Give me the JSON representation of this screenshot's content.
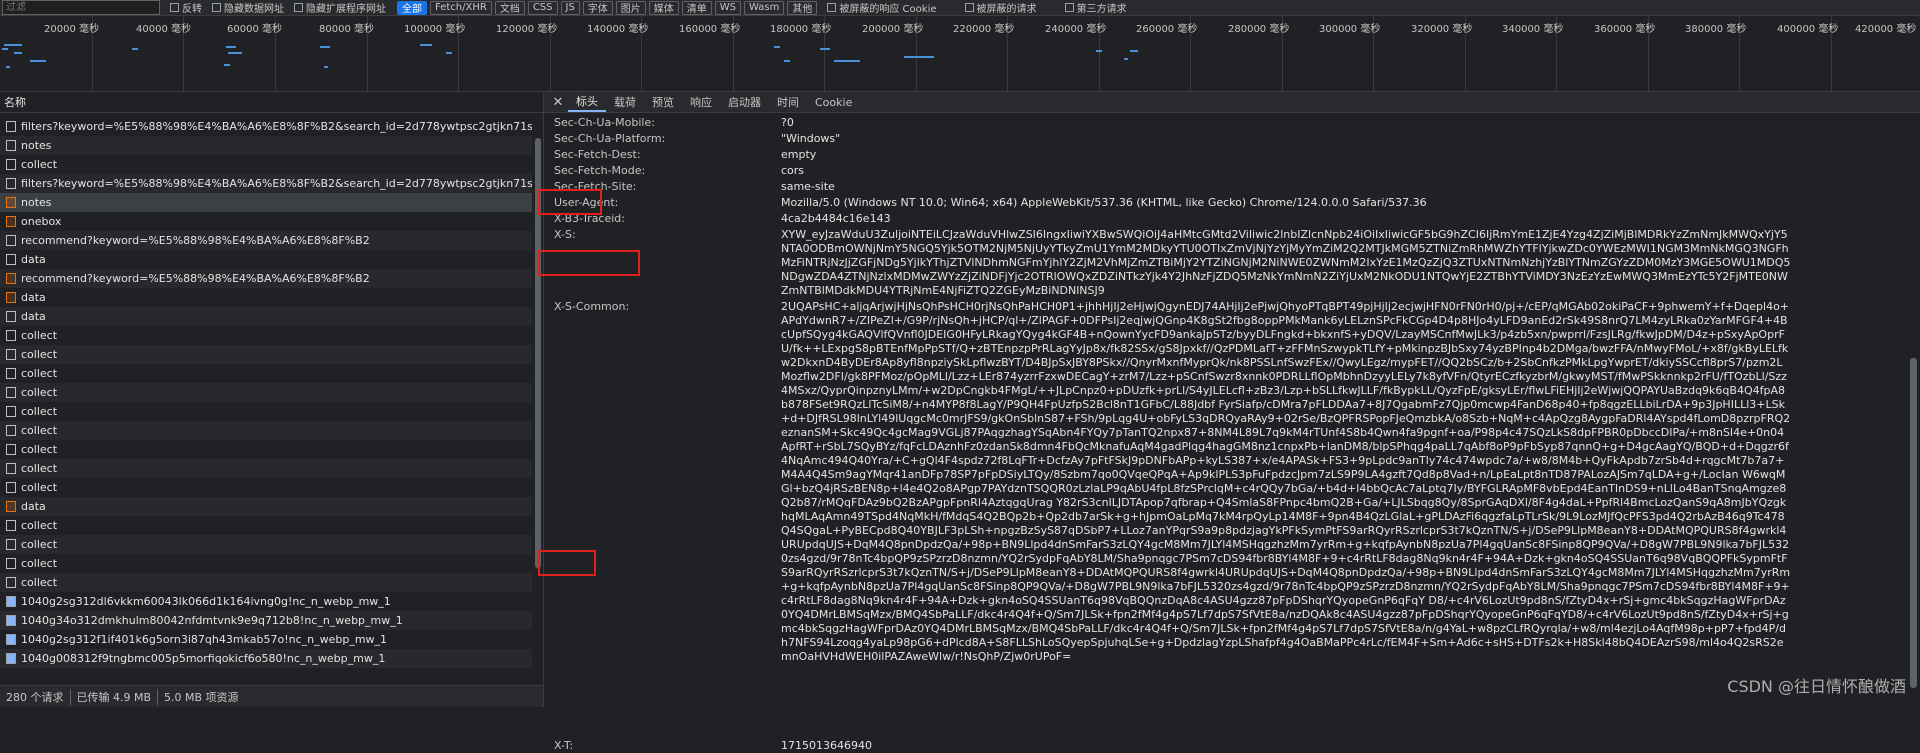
{
  "filterbar": {
    "placeholder": "过滤",
    "checks": [
      "反转",
      "隐藏数据网址",
      "隐藏扩展程序网址"
    ],
    "types": [
      "全部",
      "Fetch/XHR",
      "文档",
      "CSS",
      "JS",
      "字体",
      "图片",
      "媒体",
      "清单",
      "WS",
      "Wasm",
      "其他"
    ],
    "active_type": "全部",
    "checks2": [
      "被屏蔽的响应 Cookie",
      "被屏蔽的请求",
      "第三方请求"
    ]
  },
  "timeline": {
    "ticks": [
      "20000 毫秒",
      "40000 毫秒",
      "60000 毫秒",
      "80000 毫秒",
      "100000 毫秒",
      "120000 毫秒",
      "140000 毫秒",
      "160000 毫秒",
      "180000 毫秒",
      "200000 毫秒",
      "220000 毫秒",
      "240000 毫秒",
      "260000 毫秒",
      "280000 毫秒",
      "300000 毫秒",
      "320000 毫秒",
      "340000 毫秒",
      "360000 毫秒",
      "380000 毫秒",
      "400000 毫秒",
      "420000 毫秒"
    ]
  },
  "requests": {
    "header": "名称",
    "rows": [
      {
        "name": "filters?keyword=%E5%88%98%E4%BA%A6%E8%8F%B2&search_id=2d778ywtpsc2gtjkn71s6",
        "icon": "doc"
      },
      {
        "name": "notes",
        "icon": "doc"
      },
      {
        "name": "collect",
        "icon": "doc"
      },
      {
        "name": "filters?keyword=%E5%88%98%E4%BA%A6%E8%8F%B2&search_id=2d778ywtpsc2gtjkn71s6",
        "icon": "doc"
      },
      {
        "name": "notes",
        "icon": "xhr"
      },
      {
        "name": "onebox",
        "icon": "xhr"
      },
      {
        "name": "recommend?keyword=%E5%88%98%E4%BA%A6%E8%8F%B2",
        "icon": "doc"
      },
      {
        "name": "data",
        "icon": "doc"
      },
      {
        "name": "recommend?keyword=%E5%88%98%E4%BA%A6%E8%8F%B2",
        "icon": "xhr"
      },
      {
        "name": "data",
        "icon": "xhr"
      },
      {
        "name": "data",
        "icon": "doc"
      },
      {
        "name": "collect",
        "icon": "doc"
      },
      {
        "name": "collect",
        "icon": "doc"
      },
      {
        "name": "collect",
        "icon": "doc"
      },
      {
        "name": "collect",
        "icon": "doc"
      },
      {
        "name": "collect",
        "icon": "doc"
      },
      {
        "name": "collect",
        "icon": "doc"
      },
      {
        "name": "collect",
        "icon": "doc"
      },
      {
        "name": "collect",
        "icon": "doc"
      },
      {
        "name": "collect",
        "icon": "doc"
      },
      {
        "name": "data",
        "icon": "xhr"
      },
      {
        "name": "collect",
        "icon": "doc"
      },
      {
        "name": "collect",
        "icon": "doc"
      },
      {
        "name": "collect",
        "icon": "doc"
      },
      {
        "name": "collect",
        "icon": "doc"
      },
      {
        "name": "1040g2sg312dl6vkkm60043lk066d1k164ivng0g!nc_n_webp_mw_1",
        "icon": "img"
      },
      {
        "name": "1040g34o312dmkhulm80042nfdmtvnk9e9q712b8!nc_n_webp_mw_1",
        "icon": "img"
      },
      {
        "name": "1040g2sg312f1if401k6g5orn3i87qh43mkab57o!nc_n_webp_mw_1",
        "icon": "img"
      },
      {
        "name": "1040g008312f9tngbmc005p5morfiqokicf6o580!nc_n_webp_mw_1",
        "icon": "img"
      }
    ],
    "selected_index": 4
  },
  "status": {
    "count": "280 个请求",
    "transferred": "已传输 4.9 MB",
    "resources": "5.0 MB 项资源"
  },
  "detail": {
    "tabs": [
      "标头",
      "载荷",
      "预览",
      "响应",
      "启动器",
      "时间",
      "Cookie"
    ],
    "active_tab": "标头",
    "headers": [
      {
        "name": "Sec-Ch-Ua-Mobile:",
        "value": "?0"
      },
      {
        "name": "Sec-Ch-Ua-Platform:",
        "value": "\"Windows\""
      },
      {
        "name": "Sec-Fetch-Dest:",
        "value": "empty"
      },
      {
        "name": "Sec-Fetch-Mode:",
        "value": "cors"
      },
      {
        "name": "Sec-Fetch-Site:",
        "value": "same-site"
      },
      {
        "name": "User-Agent:",
        "value": "Mozilla/5.0 (Windows NT 10.0; Win64; x64) AppleWebKit/537.36 (KHTML, like Gecko) Chrome/124.0.0.0 Safari/537.36"
      },
      {
        "name": "X-B3-Traceid:",
        "value": "4ca2b4484c16e143"
      },
      {
        "name": "X-S:",
        "value": "XYW_eyJzaWduU3ZuljoiNTEiLCJzaWduVHlwZSI6IngxIiwiYXBwSWQiOiJ4aHMtcGMtd2ViIiwic2lnbIZlcnNpb24iOiIxIiwicGF5bG9hZCI6IjRmYmE1ZjE4Yzg4ZjZiMjBlMDRkYzZmNmJkMWQxYjY5NTA0ODBmOWNjNmY5NGQ5Yjk5OTM2NjM5NjUyYTkyZmU1YmM2MDkyYTU0OTIxZmVjNjYzYjMyYmZiM2Q2MTJkMGM5ZTNiZmRhMWZhYTFlYjkwZDc0YWEzMWI1NGM3MmNkMGQ3NGFhMzFiNTRjNzJjZGFjNDg5YjlkYThjZTVlNDhmNGFmYjhlY2ZjM2VhMjZmZTBiMjY2YTZiNGNjM2NiNWE0ZWNmM2IxYzE1MzQzZjQ3ZTUxNTNmNzhjYzBlYTNmZGYzZDM0MzY3MGE5OWU1MDQ5NDgwZDA4ZTNjNzlxMDMwZWYzZjZiNDFjYjc2OTRlOWQxZDZiNTkzYjk4Y2JhNzFjZDQ5MzNkYmNmN2ZiYjUxM2NkODU1NTQwYjE2ZTBhYTViMDY3NzEzYzEwMWQ3MmEzYTc5Y2FjMTE0NWZmNTBlMDdkMDU4YTRjNmE4NjFiZTQ2ZGEyMzBiNDNlNSJ9"
      },
      {
        "name": "X-S-Common:",
        "value": "2UQAPsHC+aljqArjwjHjNsQhPsHCH0rjNsQhPaHCH0P1+jhhHjIj2eHjwjQgynEDJ74AHjIj2ePjwjQhyoPTqBPT49pjHjIj2ecjwjHFN0rFN0rH0/pj+/cEP/qMGAb02okiPaCF+9phwemY+f+Dqepl4o+APdYdwnR7+/ZIPeZl+/G9P/rjNsQh+jHCP/ql+/ZlPAGF+0DFPsIj2eqjwjQGnp4K8gSt2fbg8oppPMkMank6yLELznSPcFkCGp4D4p8HJo4yLFD9anEd2rSk49S8nrQ7LM4zyLRka0zYarMFGF4+4BcUpfSQyg4kGAQVlfQVnfl0JDEIG0HFyLRkagYQyg4kGF4B+nQownYycFD9ankaJpSTz/byyDLFngkd+bkxnfS+yDQV/LzayMSCnfMwJLk3/p4zb5xn/pwprrl/FzsJLRg/fkwJpDM/D4z+pSxyApOprFU/fk++LExpgS8pBTEnfMpPpSTf/Q+zBTEnpzpPrRLagYyJp8x/fk82SSx/gS8Jpxkf//QzPDMLafT+zFFMnSzwypkTLfY+pMkinpzBJbSxy74yzBPInp4b2DMga/bwzFFA/nMwyFMoL/+x8f/gkByLELfkw2DkxnD4ByDEr8Ap8yfl8npziySkLpflwzBYT/D4BJpSxJBY8PSkx//QnyrMxnfMyprQk/nk8PSSLnfSwzFEx//QwyLEgz/mypFET//QQ2bSCz/b+2SbCnfkzPMkLpgYwprET/dkiySSCcfl8prS7/pzm2LMozflw2DFI/gk8PFMoz/pOpMLl/Lzz+LEr874yzrrFzxwDECagY+zrM7/Lzz+pSCnfSwzr8xnnk0PDRLLflOpMbhnDzyyLELy7k8yfVFn/QtyrECzfkyzbrM/gkwyMST/fMwPSkknnkp2rFU/fTOzbLl/Szz4MSxz/QyprQinpznyLMm/+w2DpCngkb4FMgL/++JLpCnpz0+pDUzfk+prLl/S4yJLELcfl+zBz3/Lzp+bSLLfkwJLLF/fkBypkLL/QyzFpE/gksyLEr/flwLFiEHjIj2eWjwjQQPAYUaBzdq9k6qB4Q4fpA8b878FSet9RQzLlTcSiM8/+n4MYP8f8LagY/P9QH4FpUzfpS2Bcl8nT1GFbC/L88Jdbf FyrSiafp/cDMra7pFLDDAa7+8J7QgabmFz7Qjp0mcwp4FanD68p40+fp8qgzELLbiLrDA+9p3JpHILLl3+LSk+d+DJfRSL98lnLYl49lUqgcMc0mrJFS9/gkOnSblnS87+FSh/9pLqg4U+obFyLS3qDRQyaRAy9+02rSe/BzQPFRSPopFJeQmzbkA/o8Szb+NqM+c4ApQzg8AygpFaDRl4AYspd4fLomD8pzrpFRQ2eznanSM+Skc49Qc4gcMag9VGLj87PAqgzhagYSqAbn4FYQy7pTanTQ2npx87+8NM4L89L7q9kM4rTUnf4S8b4Qwn4fa9pgnf+oa/P98p4c47SQzLkS8dpFPBR0pDbccDIPa/+m8nSI4e+0n04ApfRT+rSbL7SQyBYz/fqFcLDAznhFz0zdanSk8dmn4FbQcMknafuAqM4gadPlqg4hagGM8nz1cnpxPb+lanDM8/blpSPhqg4paLL7qAbf8oP9pFbSyp87qnnQ+g+D4gcAagYQ/BQD+d+Dqgzr6f4NqAmc494Q40Yra/+C+gQl4F4spdz72f8LqFTr+DcfzAy7pFtFSkJ9pDNFbAPp+kyLS387+x/e4APASk+FS3+9pLpdc9anTly74c474wpdc7a/+w8/8M4b+QyFkApdb7zrSb4d+rqgcMt7b7a7+M4A4Q4Sm9agYMqr41anDFp78SP7pFpDSiyLTQy/8Szbm7qo0QVqeQPqA+Ap9klPLS3pFuFpdzcJpm7zLS9P9LA4gzft7Qd8p8Vad+n/LpEaLpt8nTD87PALozAJSm7qLDA+g+/LocIan W6wqMGl+bzQ4jRSzBEN8p+l4e4Q2o8APgp7PAYdznTSQQR0zLzlaLP9qAbU4fpL8fzSPrclqM+c4rQQy7bGa/+b4d+l4bbQcAc7aLptq7Iy/BYFGLRApMF8vbEpd4EanTInDS9+nLlLo4BanTSnqAmgze8Q2b87/rMQqFDAz9bQ2BzAPgpFpnRl4AztqgqUrag Y82rS3cnILJDTApop7qfbrap+Q4SmlaS8FPnpc4bmQ2B+Ga/+LJLSbqg8Qy/8SprGAqDXl/8F4g4daL+PpfRl4BmcLozQanS9qA8mJbYQzgkhqMLAqAmn49TSpd4NqMkH/fMdqS4Q2BQp2b+Qp2db7arSk+g+hJpmOaLpMq7kM4rpQyLp14M8F+9pn4B4QzLGlaL+gPLDAzFi6qgzfaLpTLrSk/9L9LozMJfQcPFS3pd4Q2rbAzB46q9Tc478Q4SQgaL+PyBECpd8Q40YBJLF3pLSh+npgzBzSyS87qDSbP7+LLoz7anYPqrS9a9p8pdzjagYkPFkSymPtFS9arRQyrRSzrlcprS3t7kQznTN/S+j/DSeP9LlpM8eanY8+DDAtMQPQURS8f4gwrkl4URUpdqUJS+DqM4Q8pnDpdzQa/+98p+BN9Llpd4dnSmFarS3zLQY4gcM8Mm7JLYl4MSHqgzhzMm7yrRm+g+kqfpAynbN8pzUa7Pl4gqUanSc8FSinp8QP9QVa/+D8gW7PBL9N9lka7bFJL5320zs4gzd/9r78nTc4bpQP9zSPzrzD8nzmn/YQ2rSydpFqAbY8LM/Sha9pnqgc7PSm7cDS94fbr8BYl4M8F+9+c4rRtLF8dag8Nq9kn4r4F+94A+Dzk+gkn4oSQ4SSUanT6q98VqBQQPFkSypmFtFS9arRQyrRSzrlcprS3t7kQznTN/S+j/DSeP9LlpM8eanY8+DDAtMQPQURS8f4gwrkl4URUpdqUJS+DqM4Q8pnDpdzQa/+98p+BN9Llpd4dnSmFarS3zLQY4gcM8Mm7JLYl4MSHqgzhzMm7yrRm+g+kqfpAynbN8pzUa7Pl4gqUanSc8FSinp8QP9QVa/+D8gW7PBL9N9lka7bFJL5320zs4gzd/9r78nTc4bpQP9zSPzrzD8nzmn/YQ2rSydpFqAbY8LM/Sha9pnqgc7PSm7cDS94fbr8BYl4M8F+9+c4rRtLF8dag8Nq9kn4r4F+94A+Dzk+gkn4oSQ4SSUanT6q98VqBQQnzDqA8c4ASU4gzz87pFpDShqrYQyopeGnP6qFqY D8/+c4rV6LozUt9pd8nS/fZtyD4x+rSj+gmc4bkSqgzHagWFprDAz0YQ4DMrLBMSqMzx/BMQ4SbPaLLF/dkc4r4Q4f+Q/Sm7JLSk+fpn2fMf4g4pS7Lf7dpS7SfVtE8a/nzDQAk8c4ASU4gzz87pFpDShqrYQyopeGnP6qFqYD8/+c4rV6LozUt9pd8nS/fZtyD4x+rSj+gmc4bkSqgzHagWFprDAz0YQ4DMrLBMSqMzx/BMQ4SbPaLLF/dkc4r4Q4f+Q/Sm7JLSk+fpn2fMf4g4pS7Lf7dpS7SfVtE8a/n/g4YaL+w8pzCLfRQyrqla/+w8/ml4ezjLo4AqfM98p+pP7+fpd4P/dh7NFS94Lzoqg4yaLp98pG6+dPlcd8A+S8FLLShLoSQyepSpjuhqLSe+g+DpdzlagYzpLShafpf4g4OaBMaPPc4rLc/fEM4F+Sm+Ad6c+sHS+DTFs2k+H8Skl48bQ4DEAzrS98/ml4o4Q2sRS2emnOaHVHdWEH0ilPAZAweWlw/r!NsQhP/Zjw0rUPoF="
      },
      {
        "name": "X-T:",
        "value": "1715013646940"
      }
    ]
  },
  "watermark": "CSDN @往日情怀酿做酒"
}
